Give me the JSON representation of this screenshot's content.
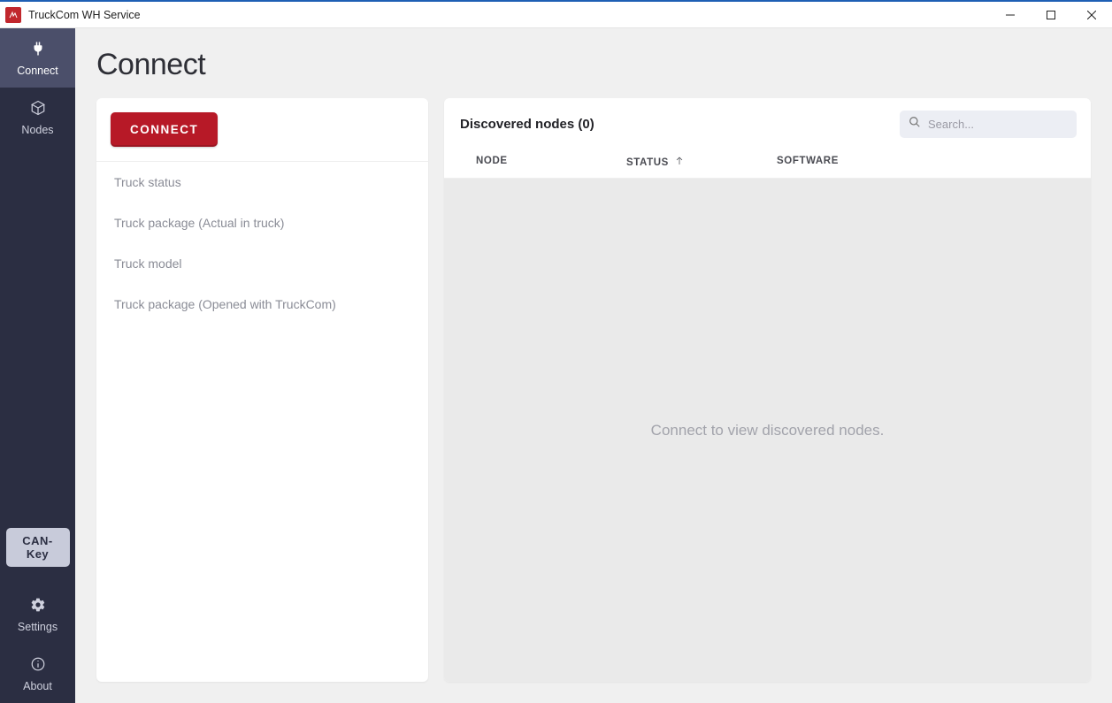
{
  "window": {
    "title": "TruckCom WH Service"
  },
  "sidebar": {
    "items": [
      {
        "label": "Connect"
      },
      {
        "label": "Nodes"
      }
    ],
    "canKeyLabel": "CAN-Key",
    "settingsLabel": "Settings",
    "aboutLabel": "About"
  },
  "page": {
    "title": "Connect",
    "connectButton": "CONNECT",
    "infoItems": [
      "Truck status",
      "Truck package (Actual in truck)",
      "Truck model",
      "Truck package (Opened with TruckCom)"
    ]
  },
  "discovered": {
    "titlePrefix": "Discovered nodes",
    "count": 0,
    "search": {
      "placeholder": "Search..."
    },
    "columns": {
      "node": "NODE",
      "status": "STATUS",
      "software": "SOFTWARE"
    },
    "emptyMessage": "Connect to view discovered nodes."
  }
}
